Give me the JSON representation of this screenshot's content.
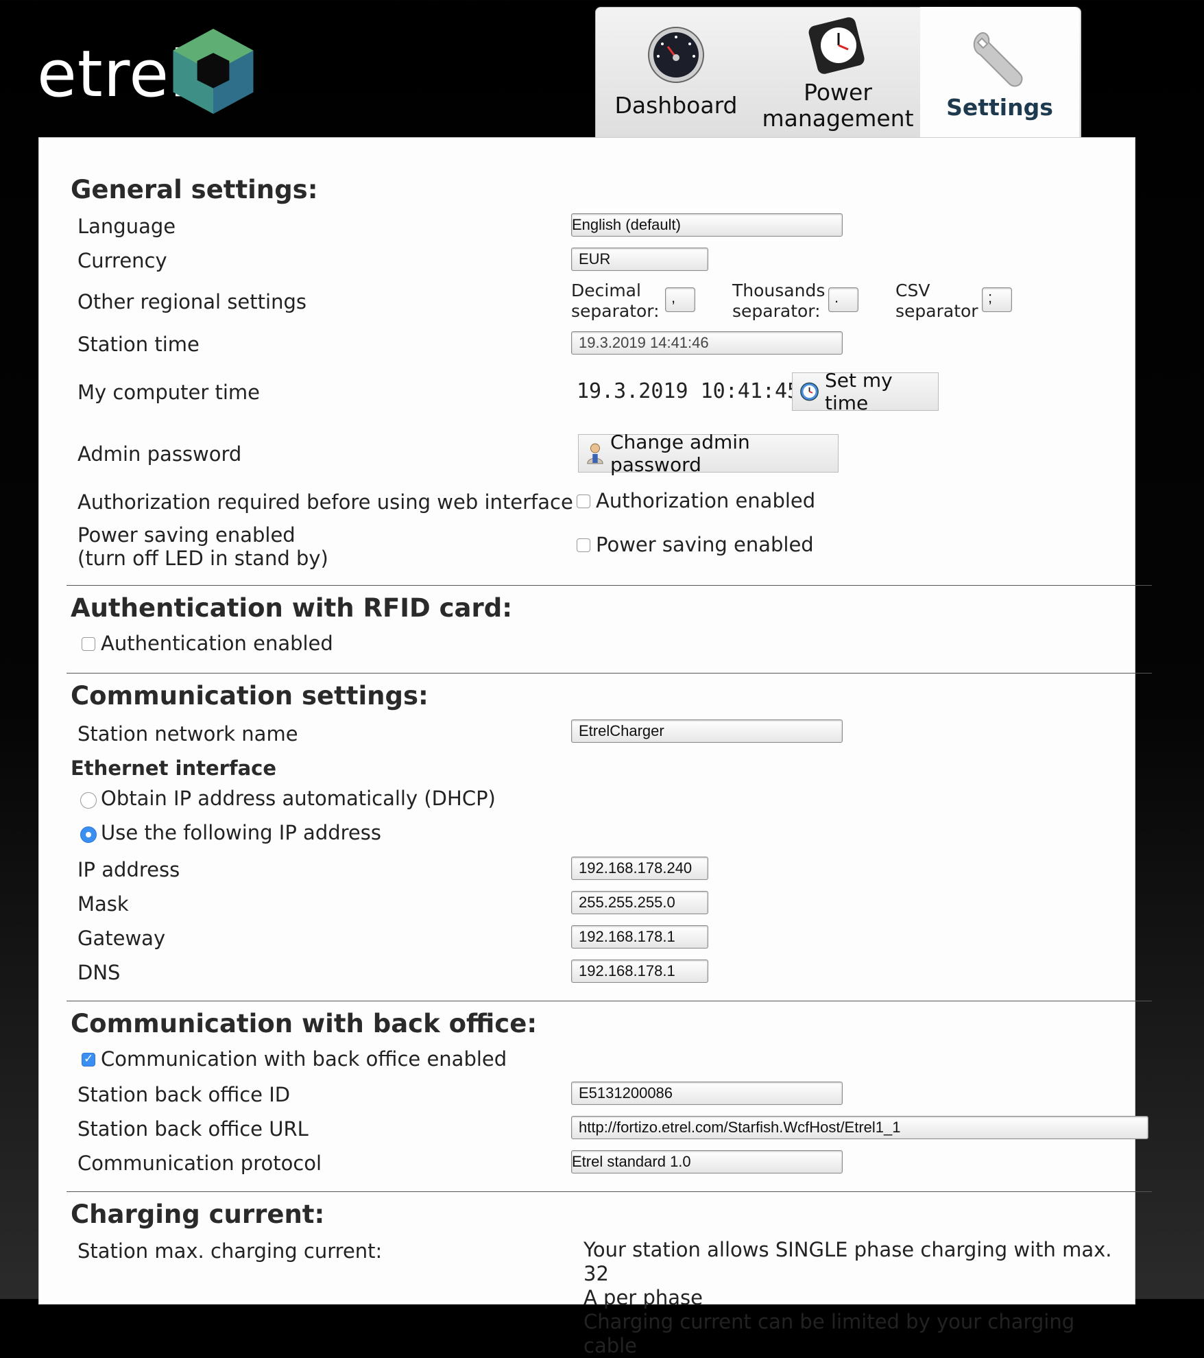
{
  "brand": {
    "name": "etrel"
  },
  "tabs": [
    {
      "label": "Dashboard",
      "icon": "dashboard-gauge-icon",
      "active": false
    },
    {
      "label": "Power\nmanagement",
      "icon": "power-clock-icon",
      "active": false
    },
    {
      "label": "Settings",
      "icon": "wrench-icon",
      "active": true
    }
  ],
  "general": {
    "title": "General settings:",
    "language_label": "Language",
    "language_value": "English (default)",
    "currency_label": "Currency",
    "currency_value": "EUR",
    "regional_label": "Other regional settings",
    "decimal_label": "Decimal separator:",
    "decimal_value": ",",
    "thousands_label": "Thousands separator:",
    "thousands_value": ".",
    "csv_label": "CSV separator",
    "csv_value": ";",
    "station_time_label": "Station time",
    "station_time_value": "19.3.2019 14:41:46",
    "computer_time_label": "My computer time",
    "computer_time_value": "19.3.2019 10:41:45",
    "set_time_button": "Set my time",
    "admin_password_label": "Admin password",
    "change_password_button": "Change admin password",
    "auth_required_label": "Authorization required before using web interface",
    "auth_enabled_label": "Authorization enabled",
    "power_saving_label_line1": "Power saving enabled",
    "power_saving_label_line2": "(turn off LED in stand by)",
    "power_saving_checkbox": "Power saving enabled"
  },
  "rfid": {
    "title": "Authentication with RFID card:",
    "enabled_label": "Authentication enabled"
  },
  "communication": {
    "title": "Communication settings:",
    "network_name_label": "Station network name",
    "network_name_value": "EtrelCharger",
    "ethernet_title": "Ethernet interface",
    "dhcp_label": "Obtain IP address automatically (DHCP)",
    "static_label": "Use the following IP address",
    "ip_label": "IP address",
    "ip_value": "192.168.178.240",
    "mask_label": "Mask",
    "mask_value": "255.255.255.0",
    "gateway_label": "Gateway",
    "gateway_value": "192.168.178.1",
    "dns_label": "DNS",
    "dns_value": "192.168.178.1"
  },
  "backoffice": {
    "title": "Communication with back office:",
    "enabled_label": "Communication with back office enabled",
    "id_label": "Station back office ID",
    "id_value": "E5131200086",
    "url_label": "Station back office URL",
    "url_value": "http://fortizo.etrel.com/Starfish.WcfHost/Etrel1_1",
    "protocol_label": "Communication protocol",
    "protocol_value": "Etrel standard 1.0"
  },
  "charging": {
    "title": "Charging current:",
    "max_label": "Station max. charging current:",
    "info_line1": "Your station allows SINGLE phase charging with max. 32",
    "info_line2": "A per phase",
    "info_line3": "Charging current can be limited by your charging cable"
  },
  "colors": {
    "accent": "#3b8ff0",
    "active_tab": "#1e3a4f"
  }
}
